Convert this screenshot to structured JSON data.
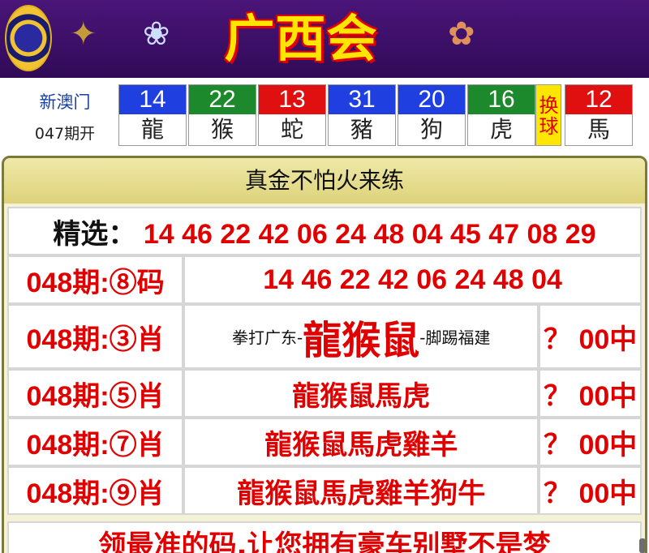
{
  "header": {
    "title": "广西会",
    "logo": "site-emblem",
    "decorations": [
      "dragon-figure",
      "dog-figure",
      "monkey-figure"
    ]
  },
  "draw": {
    "game_name": "新澳门",
    "issue": "047期开",
    "balls": [
      {
        "number": "14",
        "zodiac": "龍",
        "color": "#1f3fe0"
      },
      {
        "number": "22",
        "zodiac": "猴",
        "color": "#1c8a2c"
      },
      {
        "number": "13",
        "zodiac": "蛇",
        "color": "#e01010"
      },
      {
        "number": "31",
        "zodiac": "豬",
        "color": "#1f3fe0"
      },
      {
        "number": "20",
        "zodiac": "狗",
        "color": "#1f3fe0"
      },
      {
        "number": "16",
        "zodiac": "虎",
        "color": "#1c8a2c"
      }
    ],
    "separator": "换球",
    "special": {
      "number": "12",
      "zodiac": "馬",
      "color": "#e01010"
    }
  },
  "panel": {
    "heading": "真金不怕火来练",
    "pick_label": "精选：",
    "pick_numbers": "14 46 22 42 06 24 48 04 45 47 08 29",
    "rows": [
      {
        "label": "048期:⑧码",
        "content": "14 46 22 42 06 24 48 04"
      },
      {
        "label": "048期:③肖",
        "prefix": "拳打广东-",
        "content": "龍猴鼠",
        "suffix": "-脚踢福建",
        "result": "？ 00中"
      },
      {
        "label": "048期:⑤肖",
        "content": "龍猴鼠馬虎",
        "result": "？ 00中"
      },
      {
        "label": "048期:⑦肖",
        "content": "龍猴鼠馬虎雞羊",
        "result": "？ 00中"
      },
      {
        "label": "048期:⑨肖",
        "content": "龍猴鼠馬虎雞羊狗牛",
        "result": "？ 00中"
      }
    ],
    "slogan": "领最准的码,让您拥有豪车别墅不是梦"
  },
  "colors": {
    "banner": "#3b0f66",
    "title": "#ffe600",
    "accent_red": "#e00000",
    "panel_border": "#7a7a3a"
  }
}
